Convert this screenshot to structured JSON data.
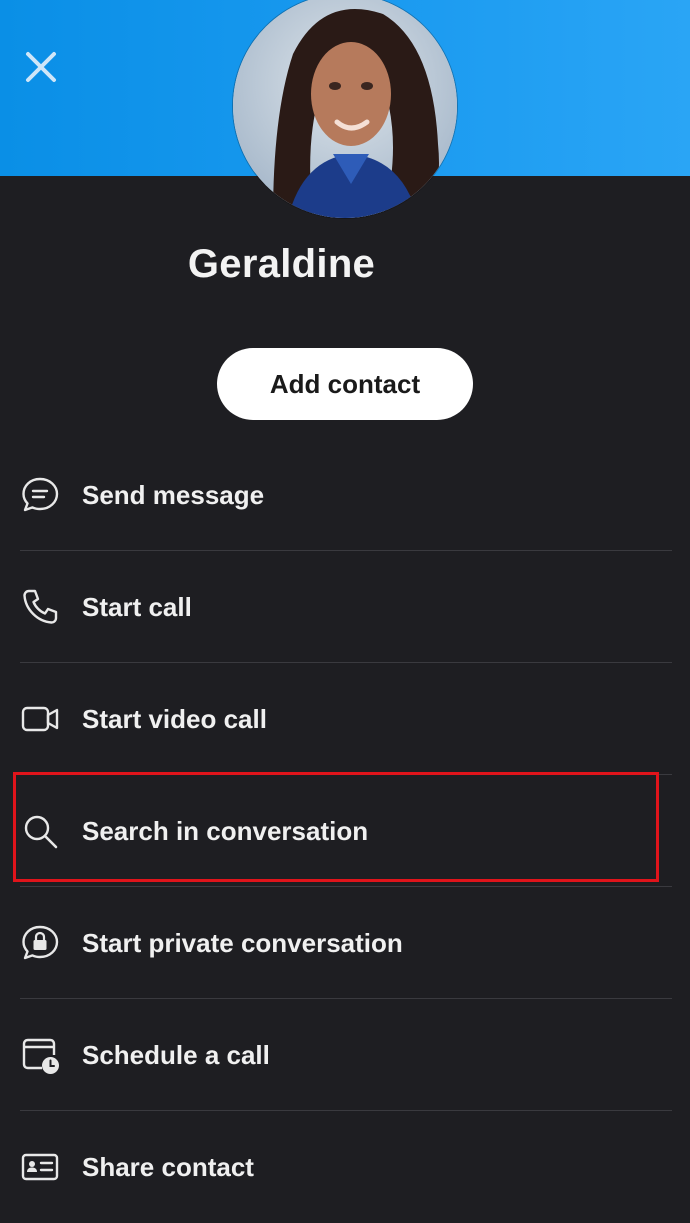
{
  "header": {
    "close_icon": "close-icon",
    "accent_color": "#1a9af0"
  },
  "profile": {
    "name": "Geraldine",
    "add_contact_label": "Add contact"
  },
  "menu": {
    "items": [
      {
        "label": "Send message",
        "icon": "chat-bubble-icon"
      },
      {
        "label": "Start call",
        "icon": "phone-icon"
      },
      {
        "label": "Start video call",
        "icon": "video-camera-icon"
      },
      {
        "label": "Search in conversation",
        "icon": "search-icon",
        "highlighted": true
      },
      {
        "label": "Start private conversation",
        "icon": "lock-chat-icon"
      },
      {
        "label": "Schedule a call",
        "icon": "calendar-clock-icon"
      },
      {
        "label": "Share contact",
        "icon": "contact-card-icon"
      }
    ]
  },
  "highlight_color": "#e0141b"
}
